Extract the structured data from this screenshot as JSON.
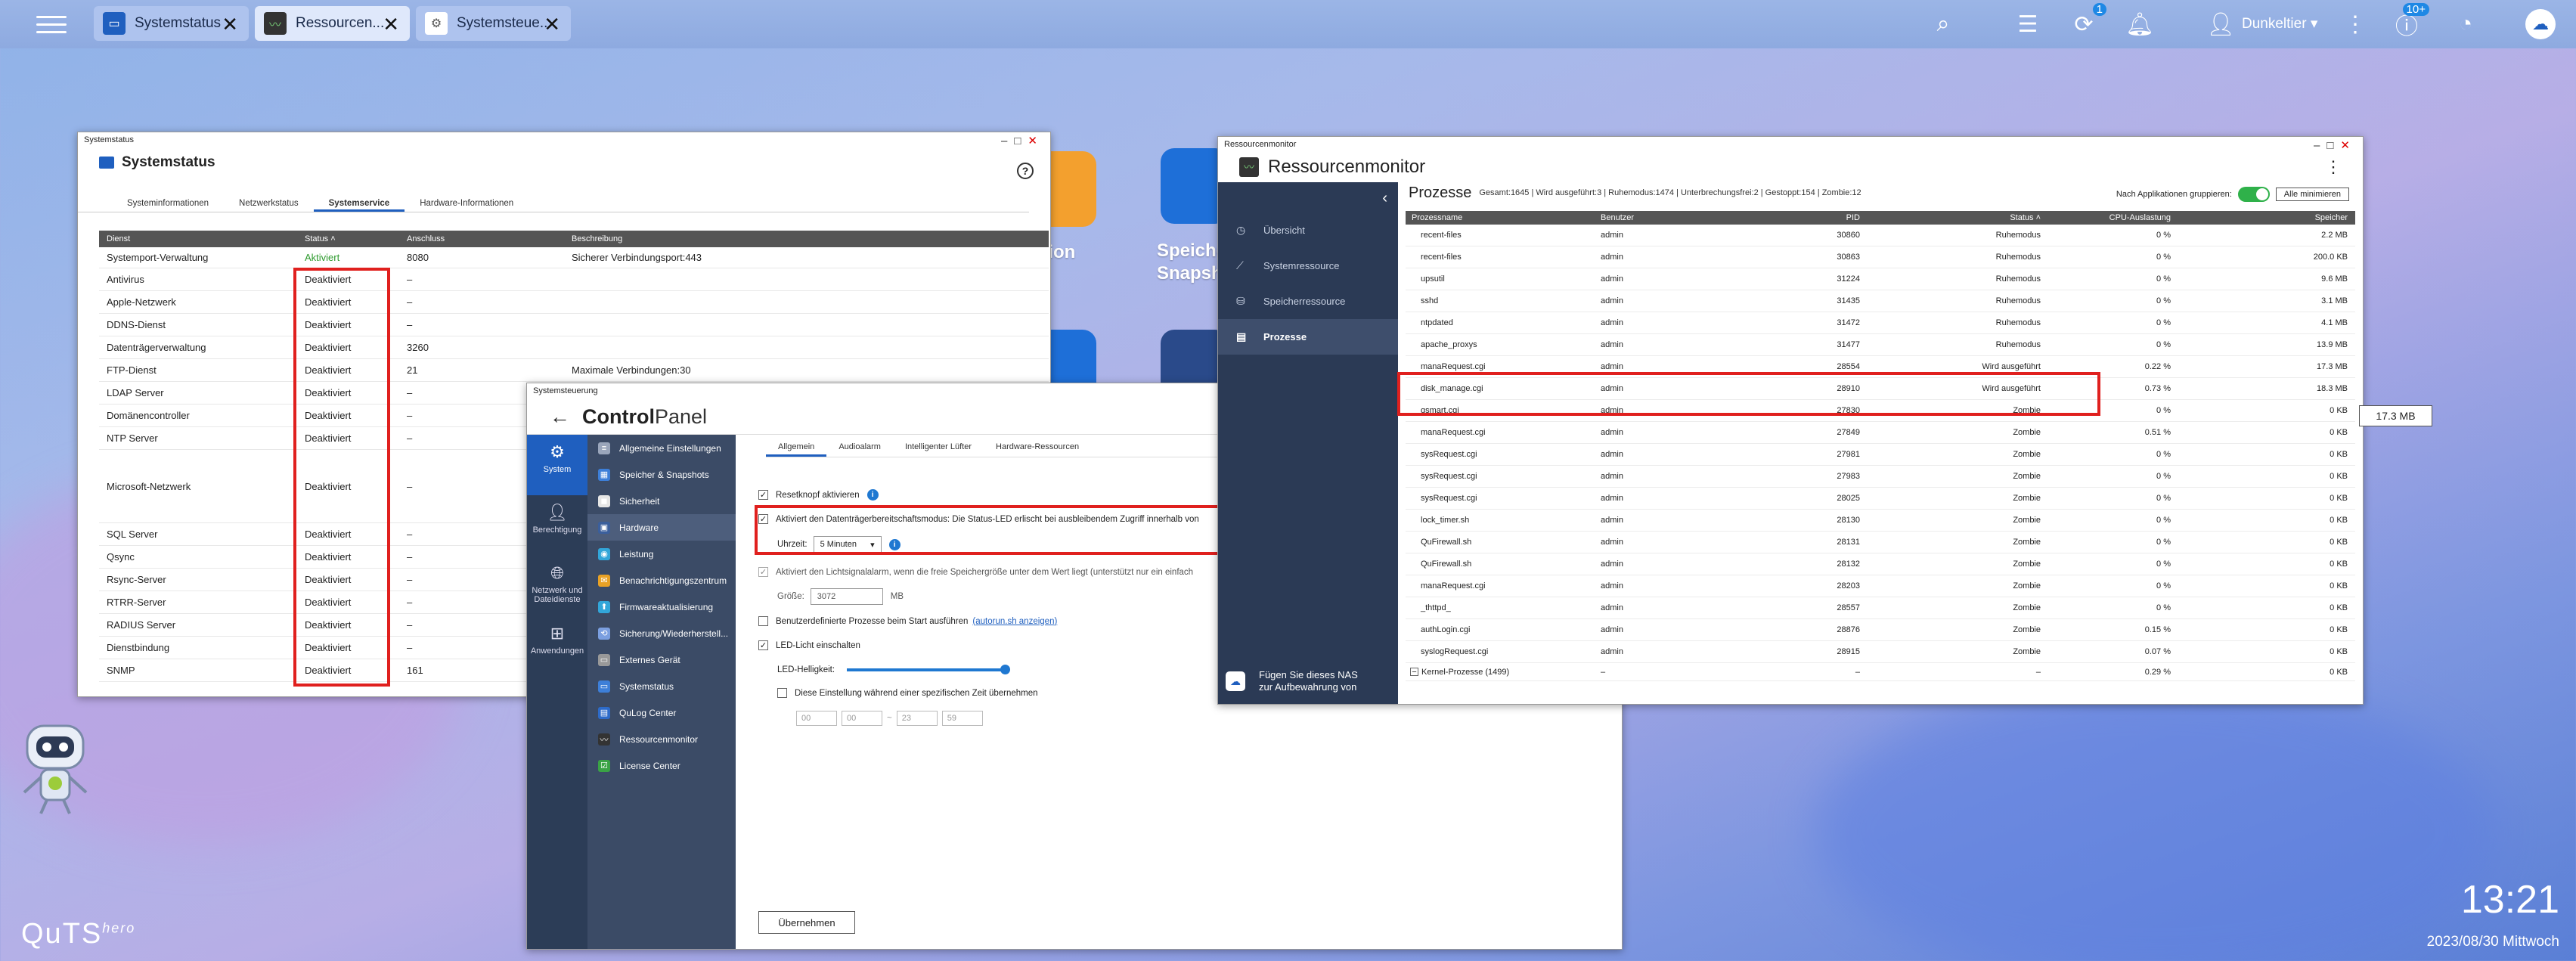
{
  "taskbar": {
    "tabs": [
      {
        "label": "Systemstatus",
        "icon": "system-status-icon"
      },
      {
        "label": "Ressourcen...",
        "icon": "resource-monitor-icon"
      },
      {
        "label": "Systemsteue...",
        "icon": "gear-icon"
      }
    ],
    "user": "Dunkeltier ▾",
    "badges": {
      "notifications": "1",
      "updates": "10+"
    }
  },
  "desktop": {
    "label1": "ation",
    "label2": "Speiche",
    "label3": "Snapsh",
    "brand": "QuTS",
    "brand_sup": "hero",
    "clock": "13:21",
    "date": "2023/08/30 Mittwoch"
  },
  "systemstatus": {
    "window_title": "Systemstatus",
    "header": "Systemstatus",
    "tabs": [
      "Systeminformationen",
      "Netzwerkstatus",
      "Systemservice",
      "Hardware-Informationen"
    ],
    "active_tab": 2,
    "columns": [
      "Dienst",
      "Status ˄",
      "Anschluss",
      "Beschreibung"
    ],
    "rows": [
      {
        "name": "Systemport-Verwaltung",
        "status": "Aktiviert",
        "port": "8080",
        "desc": "Sicherer Verbindungsport:443",
        "h": 28
      },
      {
        "name": "Antivirus",
        "status": "Deaktiviert",
        "port": "–",
        "desc": "",
        "h": 30
      },
      {
        "name": "Apple-Netzwerk",
        "status": "Deaktiviert",
        "port": "–",
        "desc": "",
        "h": 30
      },
      {
        "name": "DDNS-Dienst",
        "status": "Deaktiviert",
        "port": "–",
        "desc": "",
        "h": 30
      },
      {
        "name": "Datenträgerverwaltung",
        "status": "Deaktiviert",
        "port": "3260",
        "desc": "",
        "h": 30
      },
      {
        "name": "FTP-Dienst",
        "status": "Deaktiviert",
        "port": "21",
        "desc": "Maximale Verbindungen:30",
        "h": 30
      },
      {
        "name": "LDAP Server",
        "status": "Deaktiviert",
        "port": "–",
        "desc": "",
        "h": 30
      },
      {
        "name": "Domänencontroller",
        "status": "Deaktiviert",
        "port": "–",
        "desc": "",
        "h": 30
      },
      {
        "name": "NTP Server",
        "status": "Deaktiviert",
        "port": "–",
        "desc": "",
        "h": 30
      },
      {
        "name": "Microsoft-Netzwerk",
        "status": "Deaktiviert",
        "port": "–",
        "desc": "",
        "h": 97
      },
      {
        "name": "SQL Server",
        "status": "Deaktiviert",
        "port": "–",
        "desc": "",
        "h": 30
      },
      {
        "name": "Qsync",
        "status": "Deaktiviert",
        "port": "–",
        "desc": "",
        "h": 30
      },
      {
        "name": "Rsync-Server",
        "status": "Deaktiviert",
        "port": "–",
        "desc": "",
        "h": 30
      },
      {
        "name": "RTRR-Server",
        "status": "Deaktiviert",
        "port": "–",
        "desc": "",
        "h": 30
      },
      {
        "name": "RADIUS Server",
        "status": "Deaktiviert",
        "port": "–",
        "desc": "",
        "h": 30
      },
      {
        "name": "Dienstbindung",
        "status": "Deaktiviert",
        "port": "–",
        "desc": "",
        "h": 30
      },
      {
        "name": "SNMP",
        "status": "Deaktiviert",
        "port": "161",
        "desc": "",
        "h": 30
      }
    ]
  },
  "controlpanel": {
    "window_title": "Systemsteuerung",
    "title_bold": "Control",
    "title_thin": "Panel",
    "nav_main": [
      {
        "label": "System",
        "icon": "system-icon"
      },
      {
        "label": "Berechtigung",
        "icon": "user-icon"
      },
      {
        "label": "Netzwerk und Dateidienste",
        "icon": "globe-icon"
      },
      {
        "label": "Anwendungen",
        "icon": "apps-icon"
      }
    ],
    "nav_sub": [
      "Allgemeine Einstellungen",
      "Speicher & Snapshots",
      "Sicherheit",
      "Hardware",
      "Leistung",
      "Benachrichtigungszentrum",
      "Firmwareaktualisierung",
      "Sicherung/Wiederherstell...",
      "Externes Gerät",
      "Systemstatus",
      "QuLog Center",
      "Ressourcenmonitor",
      "License Center"
    ],
    "nav_sub_colors": [
      "#9aa6bb",
      "#3d7fd8",
      "#e6e6e6",
      "#3b5f9c",
      "#32a6d9",
      "#e8a125",
      "#32a6d9",
      "#7b9fe0",
      "#999999",
      "#3d7fd8",
      "#2d6bc9",
      "#333333",
      "#3aa345"
    ],
    "sub_tabs": [
      "Allgemein",
      "Audioalarm",
      "Intelligenter Lüfter",
      "Hardware-Ressourcen"
    ],
    "reset_label": "Resetknopf aktivieren",
    "standby_label": "Aktiviert den Datenträgerbereitschaftsmodus: Die Status-LED erlischt bei ausbleibendem Zugriff innerhalb von",
    "time_label": "Uhrzeit:",
    "time_value": "5 Minuten",
    "light_label": "Aktiviert den Lichtsignalalarm, wenn die freie Speichergröße unter dem Wert liegt (unterstützt nur ein einfach",
    "size_label": "Größe:",
    "size_value": "3072",
    "size_unit": "MB",
    "custom_label": "Benutzerdefinierte Prozesse beim Start ausführen",
    "custom_link": "(autorun.sh anzeigen)",
    "led_label": "LED-Licht einschalten",
    "brightness_label": "LED-Helligkeit:",
    "schedule_label": "Diese Einstellung während einer spezifischen Zeit übernehmen",
    "sched_values": [
      "00",
      "00",
      "23",
      "59"
    ],
    "apply": "Übernehmen"
  },
  "ressourcenmonitor": {
    "window_title": "Ressourcenmonitor",
    "header": "Ressourcenmonitor",
    "nav": [
      {
        "label": "Übersicht",
        "icon": "overview-icon"
      },
      {
        "label": "Systemressource",
        "icon": "chart-icon"
      },
      {
        "label": "Speicherressource",
        "icon": "storage-icon"
      },
      {
        "label": "Prozesse",
        "icon": "process-icon"
      }
    ],
    "promo": "Fügen Sie dieses NAS zur Aufbewahrung von",
    "title": "Prozesse",
    "stats": "Gesamt:1645 | Wird ausgeführt:3 | Ruhemodus:1474 | Unterbrechungsfrei:2 | Gestoppt:154 | Zombie:12",
    "group_label": "Nach Applikationen gruppieren:",
    "minimize": "Alle minimieren",
    "columns": [
      "Prozessname",
      "Benutzer",
      "PID",
      "Status ˄",
      "CPU-Auslastung",
      "Speicher"
    ],
    "rows": [
      [
        "recent-files",
        "admin",
        "30860",
        "Ruhemodus",
        "0 %",
        "2.2 MB"
      ],
      [
        "recent-files",
        "admin",
        "30863",
        "Ruhemodus",
        "0 %",
        "200.0 KB"
      ],
      [
        "upsutil",
        "admin",
        "31224",
        "Ruhemodus",
        "0 %",
        "9.6 MB"
      ],
      [
        "sshd",
        "admin",
        "31435",
        "Ruhemodus",
        "0 %",
        "3.1 MB"
      ],
      [
        "ntpdated",
        "admin",
        "31472",
        "Ruhemodus",
        "0 %",
        "4.1 MB"
      ],
      [
        "apache_proxys",
        "admin",
        "31477",
        "Ruhemodus",
        "0 %",
        "13.9 MB"
      ],
      [
        "manaRequest.cgi",
        "admin",
        "28554",
        "Wird ausgeführt",
        "0.22 %",
        "17.3 MB"
      ],
      [
        "disk_manage.cgi",
        "admin",
        "28910",
        "Wird ausgeführt",
        "0.73 %",
        "18.3 MB"
      ],
      [
        "qsmart.cgi",
        "admin",
        "27830",
        "Zombie",
        "0 %",
        "0 KB"
      ],
      [
        "manaRequest.cgi",
        "admin",
        "27849",
        "Zombie",
        "0.51 %",
        "0 KB"
      ],
      [
        "sysRequest.cgi",
        "admin",
        "27981",
        "Zombie",
        "0 %",
        "0 KB"
      ],
      [
        "sysRequest.cgi",
        "admin",
        "27983",
        "Zombie",
        "0 %",
        "0 KB"
      ],
      [
        "sysRequest.cgi",
        "admin",
        "28025",
        "Zombie",
        "0 %",
        "0 KB"
      ],
      [
        "lock_timer.sh",
        "admin",
        "28130",
        "Zombie",
        "0 %",
        "0 KB"
      ],
      [
        "QuFirewall.sh",
        "admin",
        "28131",
        "Zombie",
        "0 %",
        "0 KB"
      ],
      [
        "QuFirewall.sh",
        "admin",
        "28132",
        "Zombie",
        "0 %",
        "0 KB"
      ],
      [
        "manaRequest.cgi",
        "admin",
        "28203",
        "Zombie",
        "0 %",
        "0 KB"
      ],
      [
        "_thttpd_",
        "admin",
        "28557",
        "Zombie",
        "0 %",
        "0 KB"
      ],
      [
        "authLogin.cgi",
        "admin",
        "28876",
        "Zombie",
        "0.15 %",
        "0 KB"
      ],
      [
        "syslogRequest.cgi",
        "admin",
        "28915",
        "Zombie",
        "0.07 %",
        "0 KB"
      ]
    ],
    "kernel_row": [
      "Kernel-Prozesse (1499)",
      "–",
      "–",
      "–",
      "0.29 %",
      "0 KB"
    ],
    "tooltip": "17.3 MB"
  }
}
